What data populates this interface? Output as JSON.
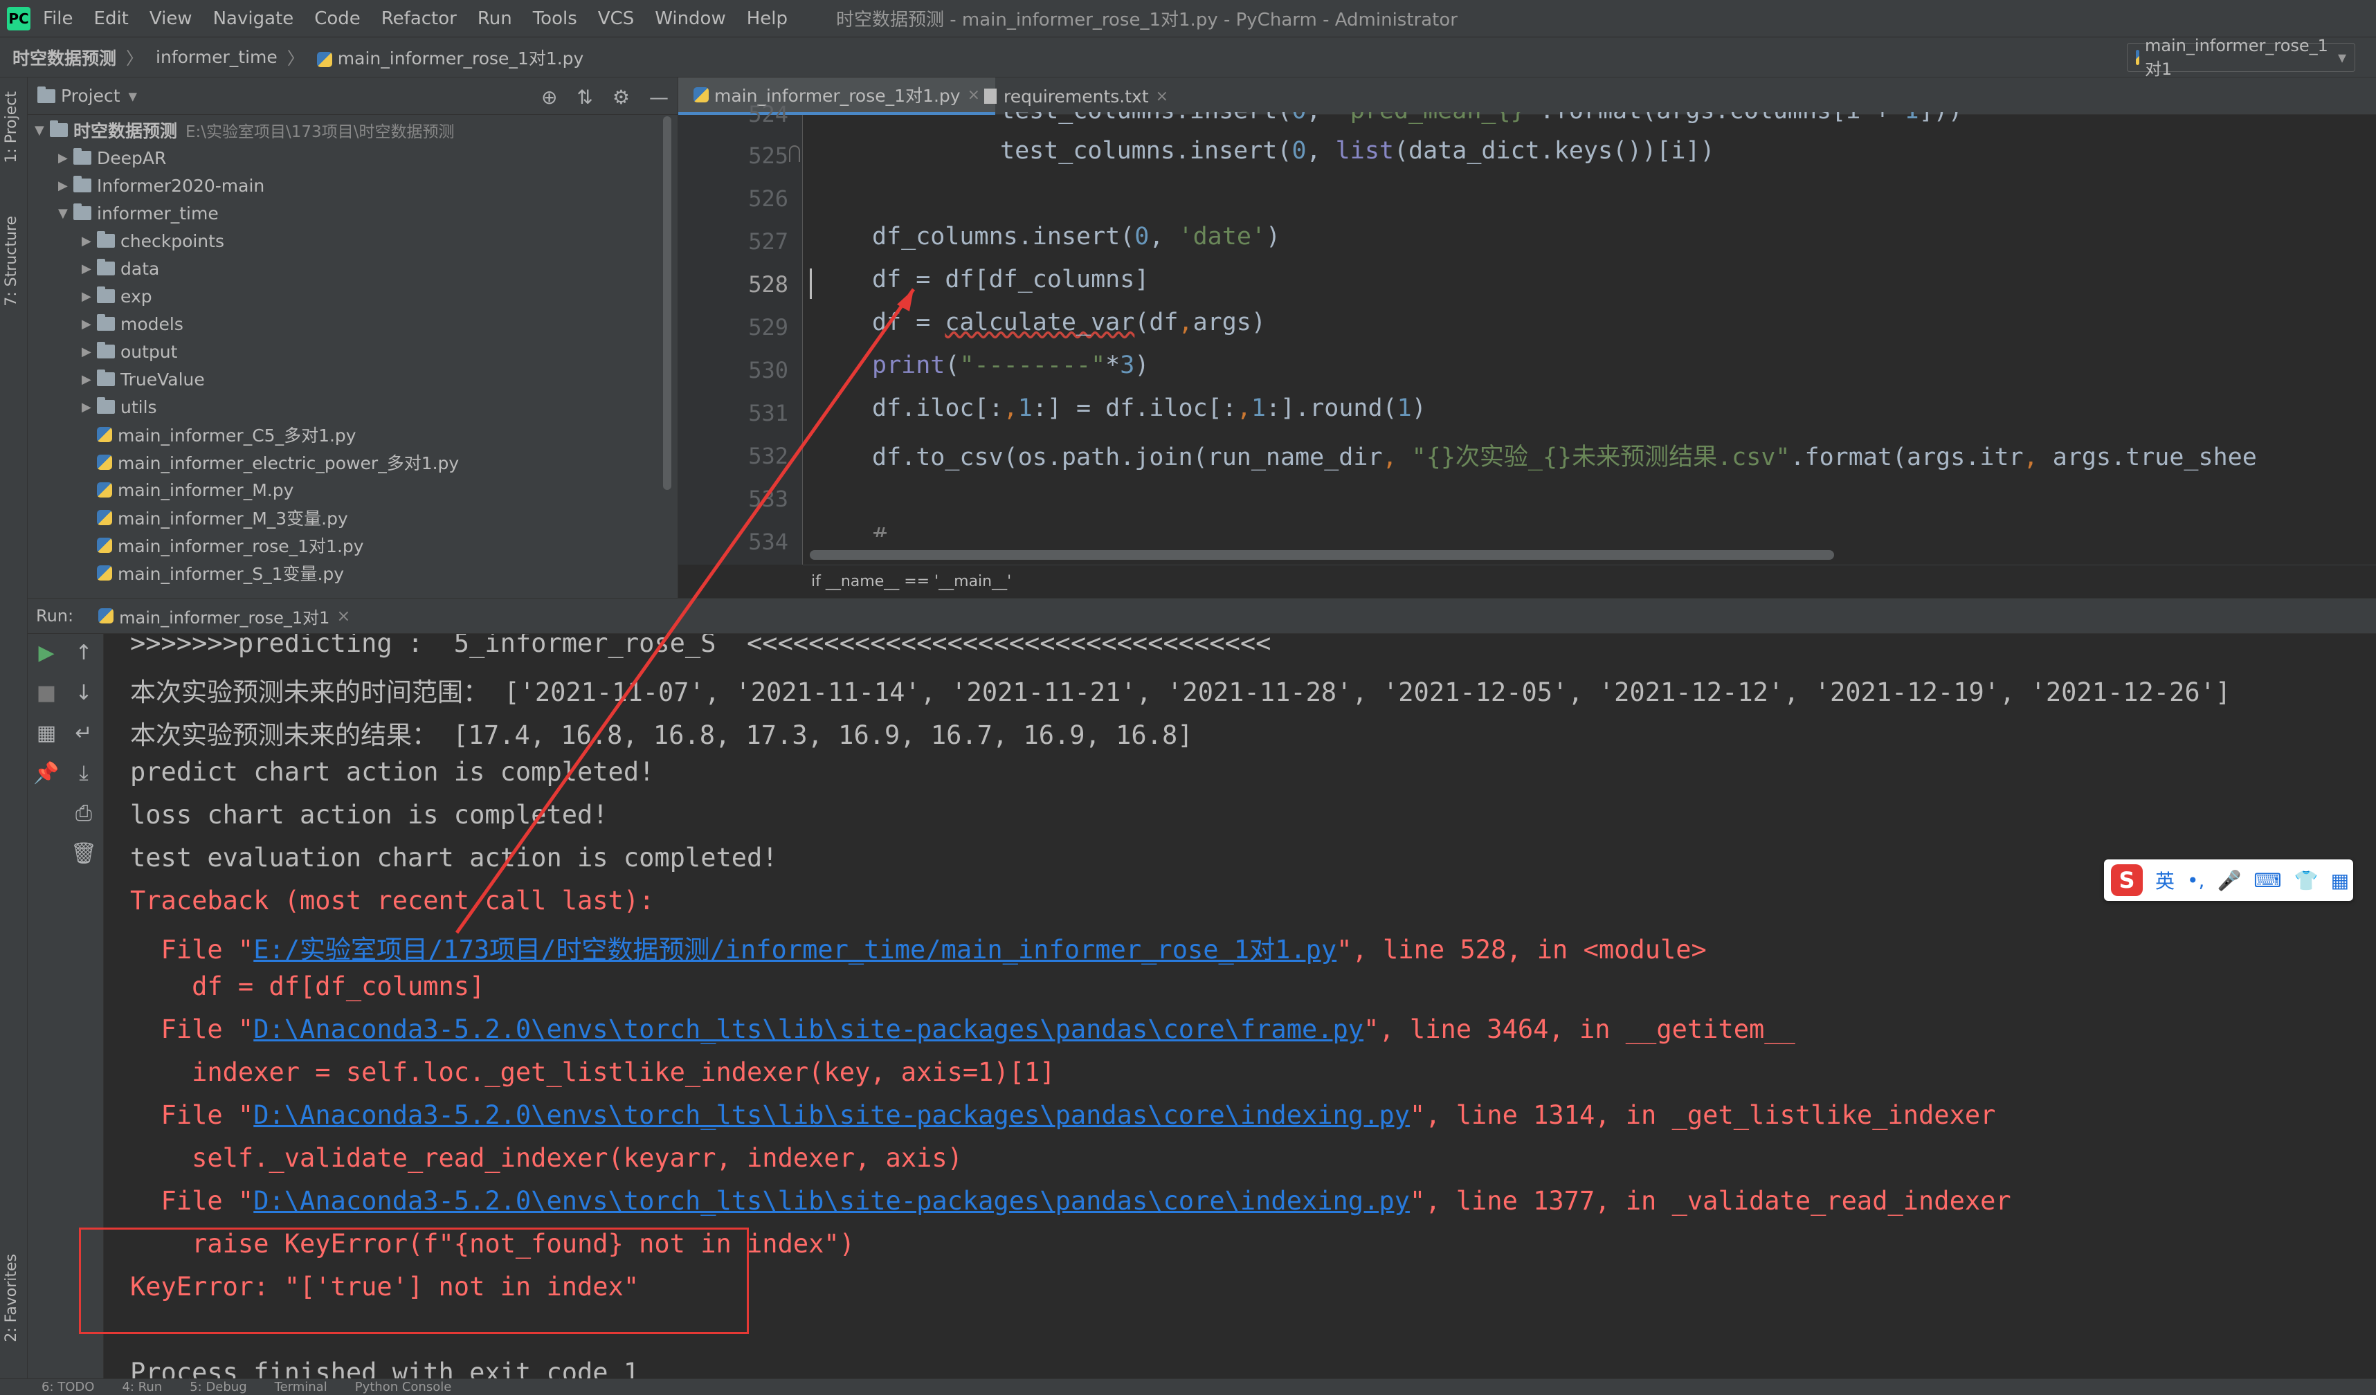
{
  "menu": {
    "items": [
      "File",
      "Edit",
      "View",
      "Navigate",
      "Code",
      "Refactor",
      "Run",
      "Tools",
      "VCS",
      "Window",
      "Help"
    ],
    "window_title": "时空数据预测 - main_informer_rose_1对1.py - PyCharm - Administrator"
  },
  "nav": {
    "crumb1": "时空数据预测",
    "crumb2": "informer_time",
    "crumb3": "main_informer_rose_1对1.py",
    "run_config": "main_informer_rose_1对1"
  },
  "sidebar": {
    "project_tab": "1: Project",
    "structure_tab": "7: Structure",
    "favorites_tab": "2: Favorites"
  },
  "project": {
    "header": "Project",
    "root": "时空数据预测",
    "root_path": "E:\\实验室项目\\173项目\\时空数据预测",
    "items": [
      {
        "label": "DeepAR",
        "type": "folder",
        "depth": 1,
        "arrow": "▶"
      },
      {
        "label": "Informer2020-main",
        "type": "folder",
        "depth": 1,
        "arrow": "▶"
      },
      {
        "label": "informer_time",
        "type": "folder",
        "depth": 1,
        "arrow": "▼"
      },
      {
        "label": "checkpoints",
        "type": "folder",
        "depth": 2,
        "arrow": "▶"
      },
      {
        "label": "data",
        "type": "folder",
        "depth": 2,
        "arrow": "▶"
      },
      {
        "label": "exp",
        "type": "folder",
        "depth": 2,
        "arrow": "▶"
      },
      {
        "label": "models",
        "type": "folder",
        "depth": 2,
        "arrow": "▶"
      },
      {
        "label": "output",
        "type": "folder",
        "depth": 2,
        "arrow": "▶"
      },
      {
        "label": "TrueValue",
        "type": "folder",
        "depth": 2,
        "arrow": "▶"
      },
      {
        "label": "utils",
        "type": "folder",
        "depth": 2,
        "arrow": "▶"
      },
      {
        "label": "main_informer_C5_多对1.py",
        "type": "py",
        "depth": 2,
        "arrow": ""
      },
      {
        "label": "main_informer_electric_power_多对1.py",
        "type": "py",
        "depth": 2,
        "arrow": ""
      },
      {
        "label": "main_informer_M.py",
        "type": "py",
        "depth": 2,
        "arrow": ""
      },
      {
        "label": "main_informer_M_3变量.py",
        "type": "py",
        "depth": 2,
        "arrow": ""
      },
      {
        "label": "main_informer_rose_1对1.py",
        "type": "py",
        "depth": 2,
        "arrow": ""
      },
      {
        "label": "main_informer_S_1变量.py",
        "type": "py",
        "depth": 2,
        "arrow": ""
      }
    ]
  },
  "editor": {
    "tabs": [
      {
        "label": "main_informer_rose_1对1.py",
        "close": "×"
      },
      {
        "label": "requirements.txt",
        "close": "×"
      }
    ],
    "line_numbers": [
      "524",
      "525",
      "526",
      "527",
      "528",
      "529",
      "530",
      "531",
      "532",
      "533",
      "534"
    ],
    "breadcrumb": "if __name__ == '__main__'"
  },
  "run": {
    "label": "Run:",
    "tab": "main_informer_rose_1对1",
    "tab_close": "×"
  },
  "console": {
    "l0": ">>>>>>>predicting :  5_informer_rose_S  <<<<<<<<<<<<<<<<<<<<<<<<<<<<<<<<<<",
    "l1": "本次实验预测未来的时间范围： ['2021-11-07', '2021-11-14', '2021-11-21', '2021-11-28', '2021-12-05', '2021-12-12', '2021-12-19', '2021-12-26']",
    "l2": "本次实验预测未来的结果： [17.4, 16.8, 16.8, 17.3, 16.9, 16.7, 16.9, 16.8]",
    "l3": "predict chart action is completed!",
    "l4": "loss chart action is completed!",
    "l5": "test evaluation chart action is completed!",
    "l6": "Traceback (most recent call last):",
    "f1_pre": "  File \"",
    "f1_link": "E:/实验室项目/173项目/时空数据预测/informer_time/main_informer_rose_1对1.py",
    "f1_post": "\", line 528, in <module>",
    "f1_code": "    df = df[df_columns]",
    "f2_pre": "  File \"",
    "f2_link": "D:\\Anaconda3-5.2.0\\envs\\torch_lts\\lib\\site-packages\\pandas\\core\\frame.py",
    "f2_post": "\", line 3464, in __getitem__",
    "f2_code": "    indexer = self.loc._get_listlike_indexer(key, axis=1)[1]",
    "f3_pre": "  File \"",
    "f3_link": "D:\\Anaconda3-5.2.0\\envs\\torch_lts\\lib\\site-packages\\pandas\\core\\indexing.py",
    "f3_post": "\", line 1314, in _get_listlike_indexer",
    "f3_code": "    self._validate_read_indexer(keyarr, indexer, axis)",
    "f4_pre": "  File \"",
    "f4_link": "D:\\Anaconda3-5.2.0\\envs\\torch_lts\\lib\\site-packages\\pandas\\core\\indexing.py",
    "f4_post": "\", line 1377, in _validate_read_indexer",
    "f4_code": "    raise KeyError(f\"{not_found} not in index\")",
    "keyerror": "KeyError: \"['true'] not in index\"",
    "finished": "Process finished with exit code 1"
  },
  "ime": {
    "lang": "英",
    "punct": "•,",
    "logo": "S"
  },
  "status": {
    "items": [
      "6: TODO",
      "4: Run",
      "5: Debug",
      "Terminal",
      "Python Console"
    ]
  },
  "colors": {
    "error": "#ff6b68",
    "link": "#287bde",
    "annotation_box": "#e53935"
  }
}
